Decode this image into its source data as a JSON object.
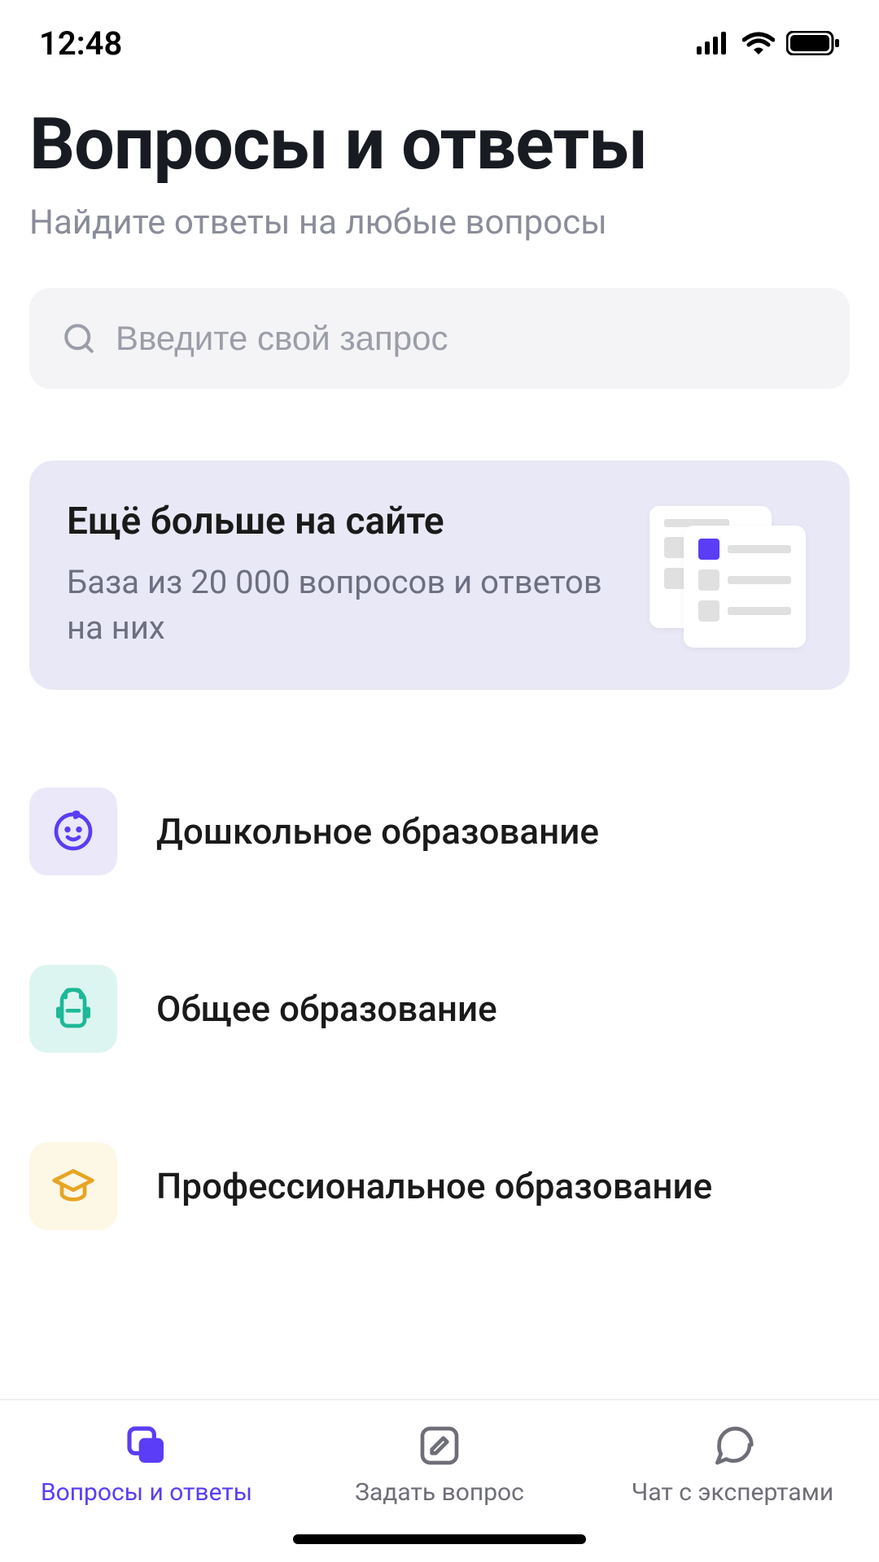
{
  "status": {
    "time": "12:48"
  },
  "header": {
    "title": "Вопросы и ответы",
    "subtitle": "Найдите ответы на любые вопросы"
  },
  "search": {
    "placeholder": "Введите свой запрос"
  },
  "promo": {
    "title": "Ещё больше на сайте",
    "description": "База из 20 000 вопросов и ответов на них"
  },
  "categories": [
    {
      "label": "Дошкольное образование",
      "icon": "baby-face-icon",
      "variant": "purple"
    },
    {
      "label": "Общее образование",
      "icon": "backpack-icon",
      "variant": "teal"
    },
    {
      "label": "Профессиональное образование",
      "icon": "graduation-cap-icon",
      "variant": "yellow"
    }
  ],
  "nav": {
    "items": [
      {
        "label": "Вопросы и ответы",
        "icon": "cards-icon",
        "active": true
      },
      {
        "label": "Задать вопрос",
        "icon": "edit-square-icon",
        "active": false
      },
      {
        "label": "Чат с экспертами",
        "icon": "chat-bubble-icon",
        "active": false
      }
    ]
  }
}
